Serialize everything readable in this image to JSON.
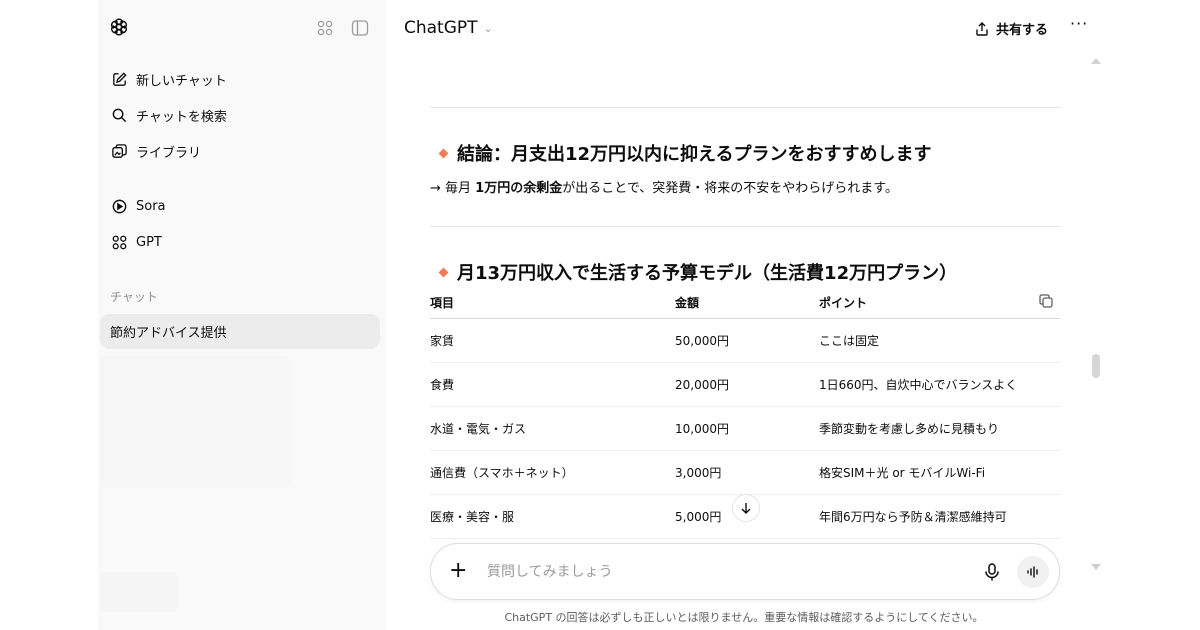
{
  "sidebar": {
    "items": [
      {
        "label": "新しいチャット",
        "icon": "edit-icon"
      },
      {
        "label": "チャットを検索",
        "icon": "search-icon"
      },
      {
        "label": "ライブラリ",
        "icon": "library-icon"
      },
      {
        "label": "Sora",
        "icon": "play-icon"
      },
      {
        "label": "GPT",
        "icon": "grid-icon"
      }
    ],
    "section_label": "チャット",
    "active_chat": "節約アドバイス提供"
  },
  "header": {
    "model": "ChatGPT",
    "share_label": "共有する",
    "more_label": "···"
  },
  "content": {
    "conclusion_heading": "結論：月支出12万円以内に抑えるプランをおすすめします",
    "sub_prefix": "→ 毎月 ",
    "sub_bold": "1万円の余剰金",
    "sub_suffix": "が出ることで、突発費・将来の不安をやわらげられます。",
    "budget_heading": "月13万円収入で生活する予算モデル（生活費12万円プラン）",
    "table": {
      "headers": [
        "項目",
        "金額",
        "ポイント"
      ],
      "rows": [
        [
          "家賃",
          "50,000円",
          "ここは固定"
        ],
        [
          "食費",
          "20,000円",
          "1日660円、自炊中心でバランスよく"
        ],
        [
          "水道・電気・ガス",
          "10,000円",
          "季節変動を考慮し多めに見積もり"
        ],
        [
          "通信費（スマホ＋ネット）",
          "3,000円",
          "格安SIM＋光 or モバイルWi-Fi"
        ],
        [
          "医療・美容・服",
          "5,000円",
          "年間6万円なら予防＆清潔感維持可"
        ]
      ]
    }
  },
  "composer": {
    "plus": "+",
    "placeholder": "質問してみましょう"
  },
  "footer": {
    "disclaimer": "ChatGPT の回答は必ずしも正しいとは限りません。重要な情報は確認するようにしてください。"
  },
  "colors": {
    "accent_diamond": "#f07b57",
    "sidebar_bg": "#f9f9f9",
    "active_chat_bg": "#ececec"
  }
}
